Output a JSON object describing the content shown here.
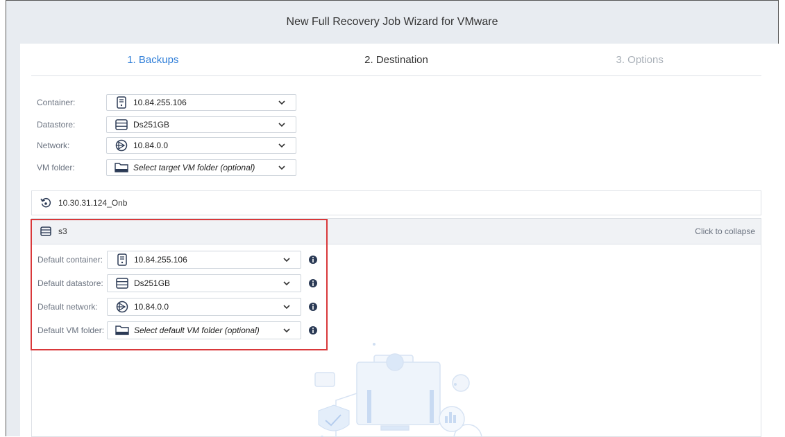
{
  "window": {
    "title": "New Full Recovery Job Wizard for VMware"
  },
  "steps": [
    {
      "label": "1. Backups",
      "state": "active"
    },
    {
      "label": "2. Destination",
      "state": "done"
    },
    {
      "label": "3. Options",
      "state": "disabled"
    }
  ],
  "target": {
    "container": {
      "label": "Container:",
      "value": "10.84.255.106",
      "icon": "server-icon"
    },
    "datastore": {
      "label": "Datastore:",
      "value": "Ds251GB",
      "icon": "datastore-icon"
    },
    "network": {
      "label": "Network:",
      "value": "10.84.0.0",
      "icon": "network-icon"
    },
    "vm_folder": {
      "label": "VM folder:",
      "value": "Select target VM folder (optional)",
      "icon": "folder-icon"
    }
  },
  "source": {
    "name": "10.30.31.124_Onb",
    "icon": "restore-icon"
  },
  "group": {
    "name": "s3",
    "collapse_label": "Click to collapse",
    "container": {
      "label": "Default container:",
      "value": "10.84.255.106"
    },
    "datastore": {
      "label": "Default datastore:",
      "value": "Ds251GB"
    },
    "network": {
      "label": "Default network:",
      "value": "10.84.0.0"
    },
    "vm_folder": {
      "label": "Default VM folder:",
      "value": "Select default VM folder (optional)"
    }
  },
  "colors": {
    "accent": "#2f7ed8",
    "highlight": "#d9383a",
    "icon": "#2b3a55"
  }
}
